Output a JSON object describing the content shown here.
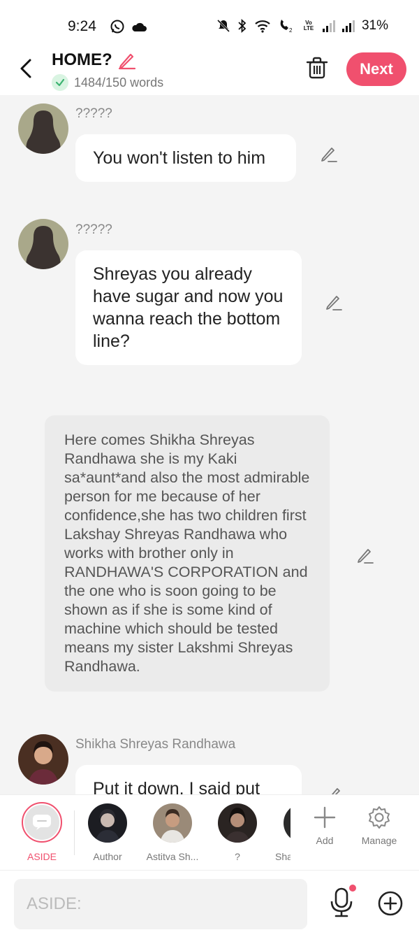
{
  "status_bar": {
    "time": "9:24",
    "battery": "31%",
    "volte": "Vo LTE"
  },
  "header": {
    "title": "HOME?",
    "word_count": "1484/150 words",
    "next_label": "Next"
  },
  "messages": [
    {
      "type": "dialogue",
      "sender": "?????",
      "text": "You won't listen to him"
    },
    {
      "type": "dialogue",
      "sender": "?????",
      "text": "Shreyas you already have sugar and now you wanna reach the bottom line?"
    },
    {
      "type": "aside",
      "text": "Here comes Shikha Shreyas Randhawa she is my Kaki sa*aunt*and also the most admirable person for me because of her confidence,she has two children first Lakshay Shreyas Randhawa who works with brother only in RANDHAWA'S CORPORATION and the one who is soon going to be shown as if she is some kind of machine which should be tested means my sister Lakshmi Shreyas Randhawa."
    },
    {
      "type": "dialogue",
      "sender": "Shikha Shreyas Randhawa",
      "text": "Put it down. I said put"
    }
  ],
  "characters": [
    {
      "label": "ASIDE",
      "active": true
    },
    {
      "label": "Author"
    },
    {
      "label": "Astitva Sh..."
    },
    {
      "label": "?"
    },
    {
      "label": "Sha"
    }
  ],
  "actions": {
    "add_label": "Add",
    "manage_label": "Manage"
  },
  "input": {
    "placeholder": "ASIDE:"
  },
  "colors": {
    "accent": "#f0506e",
    "background": "#f4f4f4",
    "aside_bubble": "#ebebeb"
  }
}
